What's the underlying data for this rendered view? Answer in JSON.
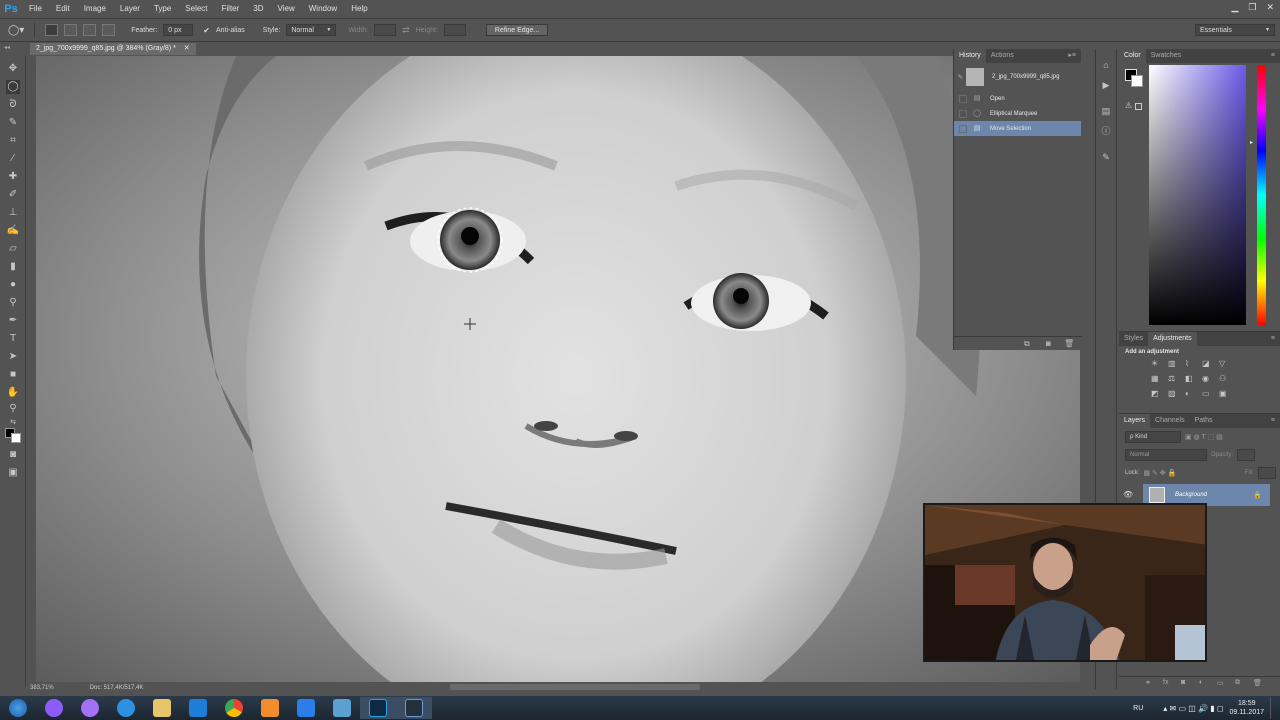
{
  "app": {
    "logo": "Ps",
    "menus": [
      "File",
      "Edit",
      "Image",
      "Layer",
      "Type",
      "Select",
      "Filter",
      "3D",
      "View",
      "Window",
      "Help"
    ]
  },
  "options": {
    "feather_label": "Feather:",
    "feather_value": "0 px",
    "antialias_label": "Anti-alias",
    "style_label": "Style:",
    "style_value": "Normal",
    "width_label": "Width:",
    "height_label": "Height:",
    "refine_label": "Refine Edge...",
    "workspace": "Essentials"
  },
  "document": {
    "tab_title": "2_jpg_700x9999_q85.jpg @ 384% (Gray/8) *"
  },
  "status": {
    "zoom": "383,71%",
    "doc_size": "Doc: 517,4K/517,4K"
  },
  "history": {
    "tabs": [
      "History",
      "Actions"
    ],
    "snapshot": "2_jpg_700x9999_q85.jpg",
    "items": [
      {
        "label": "Open"
      },
      {
        "label": "Elliptical Marquee"
      },
      {
        "label": "Move Selection"
      }
    ]
  },
  "color_panel": {
    "tabs": [
      "Color",
      "Swatches"
    ]
  },
  "adjustments": {
    "tabs": [
      "Styles",
      "Adjustments"
    ],
    "heading": "Add an adjustment"
  },
  "layers": {
    "tabs": [
      "Layers",
      "Channels",
      "Paths"
    ],
    "kind": "ρ Kind",
    "blend_mode": "Normal",
    "opacity_label": "Opacity:",
    "lock_label": "Lock:",
    "fill_label": "Fill:",
    "layer_name": "Background"
  },
  "tray": {
    "lang": "RU",
    "time": "18:59",
    "date": "09.11.2017"
  },
  "colors": {
    "ui_bg": "#535353",
    "selection_blue": "#6d86ab",
    "ps_blue": "#2fa3e8"
  }
}
